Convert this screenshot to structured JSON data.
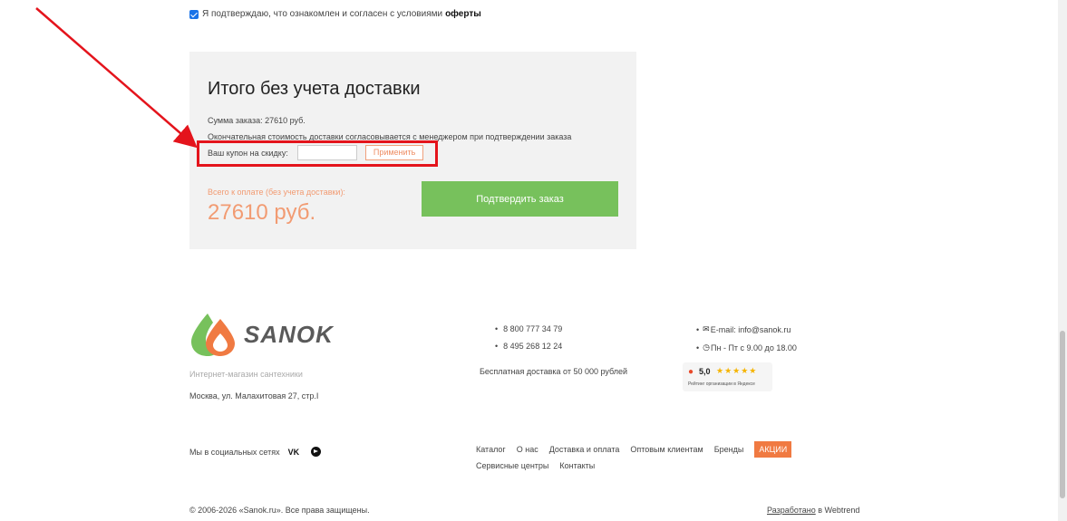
{
  "agreement": {
    "text": "Я подтверждаю, что ознакомлен и согласен с условиями",
    "link": "оферты",
    "checked": true
  },
  "summary": {
    "title": "Итого без учета доставки",
    "order_sum": "Сумма заказа: 27610 руб.",
    "delivery_note": "Окончательная стоимость доставки согласовывается с менеджером при подтверждении заказа",
    "coupon_label": "Ваш купон на скидку:",
    "coupon_value": "",
    "apply_label": "Применить",
    "total_label": "Всего к оплате (без учета доставки):",
    "total_value": "27610 руб.",
    "confirm_label": "Подтвердить заказ"
  },
  "footer": {
    "logo_text": "SANOK",
    "tagline": "Интернет-магазин сантехники",
    "address": "Москва, ул. Малахитовая 27, стр.I",
    "phones": [
      "8 800 777 34 79",
      "8 495 268 12 24"
    ],
    "free_delivery": "Бесплатная доставка от 50 000 рублей",
    "email": "E-mail: info@sanok.ru",
    "hours": "Пн - Пт с 9.00 до 18.00",
    "rating": {
      "value": "5,0",
      "stars": "★★★★★",
      "caption": "Рейтинг организации в Яндексе"
    },
    "social_label": "Мы в социальных сетях",
    "vk_label": "VK",
    "menu": [
      "Каталог",
      "О нас",
      "Доставка и оплата",
      "Оптовым клиентам",
      "Бренды",
      "АКЦИИ",
      "Сервисные центры",
      "Контакты"
    ],
    "copyright": "© 2006-2026 «Sanok.ru». Все права защищены.",
    "developer_link": "Разработано",
    "developer_suffix": " в Webtrend"
  },
  "colors": {
    "accent_orange": "#f29b72",
    "confirm_green": "#77c15c",
    "highlight_red": "#e4141c",
    "promo_orange": "#f07a42"
  }
}
